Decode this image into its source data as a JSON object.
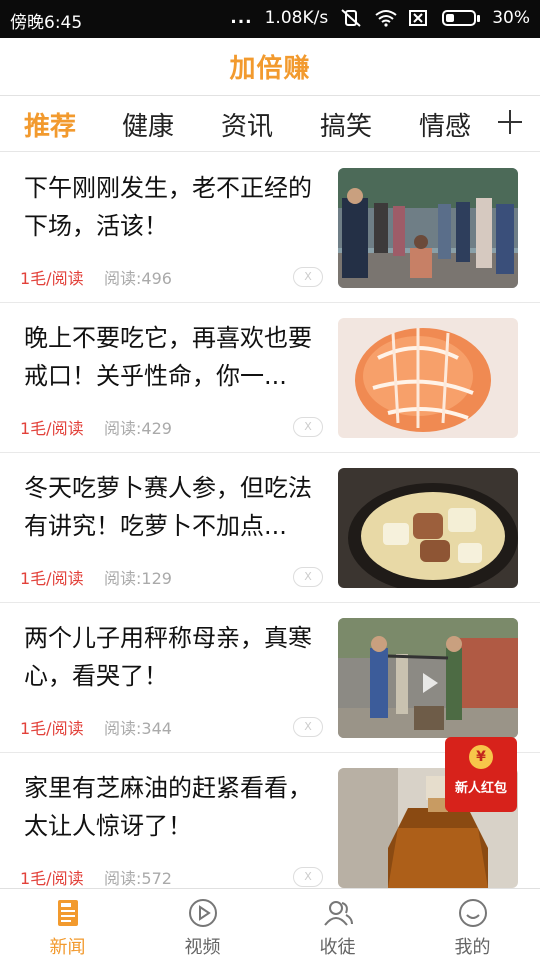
{
  "status_bar": {
    "time": "傍晚6:45",
    "dots": "...",
    "network_speed": "1.08K/s",
    "battery": "30%",
    "battery_level": 0.3,
    "icons": [
      "vibrate-off-icon",
      "wifi-icon",
      "no-sim-icon",
      "battery-icon"
    ]
  },
  "header": {
    "title": "加倍赚"
  },
  "tabs": [
    {
      "label": "推荐",
      "active": true
    },
    {
      "label": "健康",
      "active": false
    },
    {
      "label": "资讯",
      "active": false
    },
    {
      "label": "搞笑",
      "active": false
    },
    {
      "label": "情感",
      "active": false
    }
  ],
  "tabs_add_icon": "plus-icon",
  "articles": [
    {
      "title": "下午刚刚发生，老不正经的下场，活该！",
      "reward": "1毛/阅读",
      "reads": "阅读:496",
      "close": "X",
      "thumb": "crowd-street-photo"
    },
    {
      "title": "晚上不要吃它，再喜欢也要戒口！关乎性命，你一...",
      "reward": "1毛/阅读",
      "reads": "阅读:429",
      "close": "X",
      "thumb": "peeled-orange-photo"
    },
    {
      "title": "冬天吃萝卜赛人参，但吃法有讲究！吃萝卜不加点...",
      "reward": "1毛/阅读",
      "reads": "阅读:129",
      "close": "X",
      "thumb": "radish-stew-photo"
    },
    {
      "title": "两个儿子用秤称母亲，真寒心，看哭了！",
      "reward": "1毛/阅读",
      "reads": "阅读:344",
      "close": "X",
      "thumb": "village-people-video"
    },
    {
      "title": "家里有芝麻油的赶紧看看，太让人惊讶了！",
      "reward": "1毛/阅读",
      "reads": "阅读:572",
      "close": "X",
      "thumb": "sesame-oil-bottle-photo"
    }
  ],
  "red_packet": {
    "coin": "¥",
    "label": "新人红包"
  },
  "bottom_nav": [
    {
      "label": "新闻",
      "icon": "news-icon",
      "active": true
    },
    {
      "label": "视频",
      "icon": "play-icon",
      "active": false
    },
    {
      "label": "收徒",
      "icon": "people-icon",
      "active": false
    },
    {
      "label": "我的",
      "icon": "smiley-icon",
      "active": false
    }
  ],
  "colors": {
    "accent": "#f29a2e",
    "reward_red": "#e2413a",
    "status_bar": "#0b0b0b",
    "red_packet": "#d7221b"
  }
}
